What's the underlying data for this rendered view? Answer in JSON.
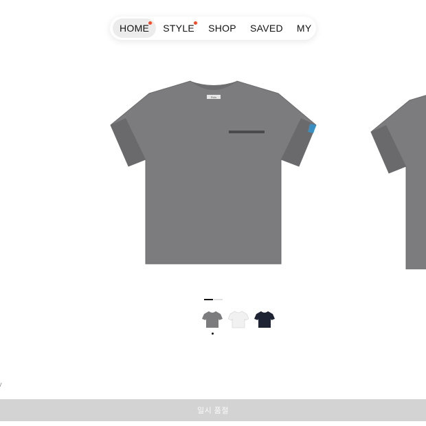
{
  "nav": {
    "items": [
      {
        "label": "HOME",
        "active": true,
        "dot": true
      },
      {
        "label": "STYLE",
        "active": false,
        "dot": true
      },
      {
        "label": "SHOP",
        "active": false,
        "dot": false
      },
      {
        "label": "SAVED",
        "active": false,
        "dot": false
      },
      {
        "label": "MY",
        "active": false,
        "dot": false
      }
    ],
    "dot_color": "#ef4b2c"
  },
  "product": {
    "shirt_color": "#7c7c7e",
    "tag_text": "Rolo",
    "gallery_page": 1,
    "gallery_total": 2,
    "swatches": [
      {
        "name": "gray",
        "color": "#7c7c7e",
        "selected": true
      },
      {
        "name": "white",
        "color": "#f1f1f1",
        "selected": false
      },
      {
        "name": "navy",
        "color": "#1e2433",
        "selected": false
      }
    ]
  },
  "side_text": "y",
  "status": {
    "soldout_label": "일시 품절"
  }
}
